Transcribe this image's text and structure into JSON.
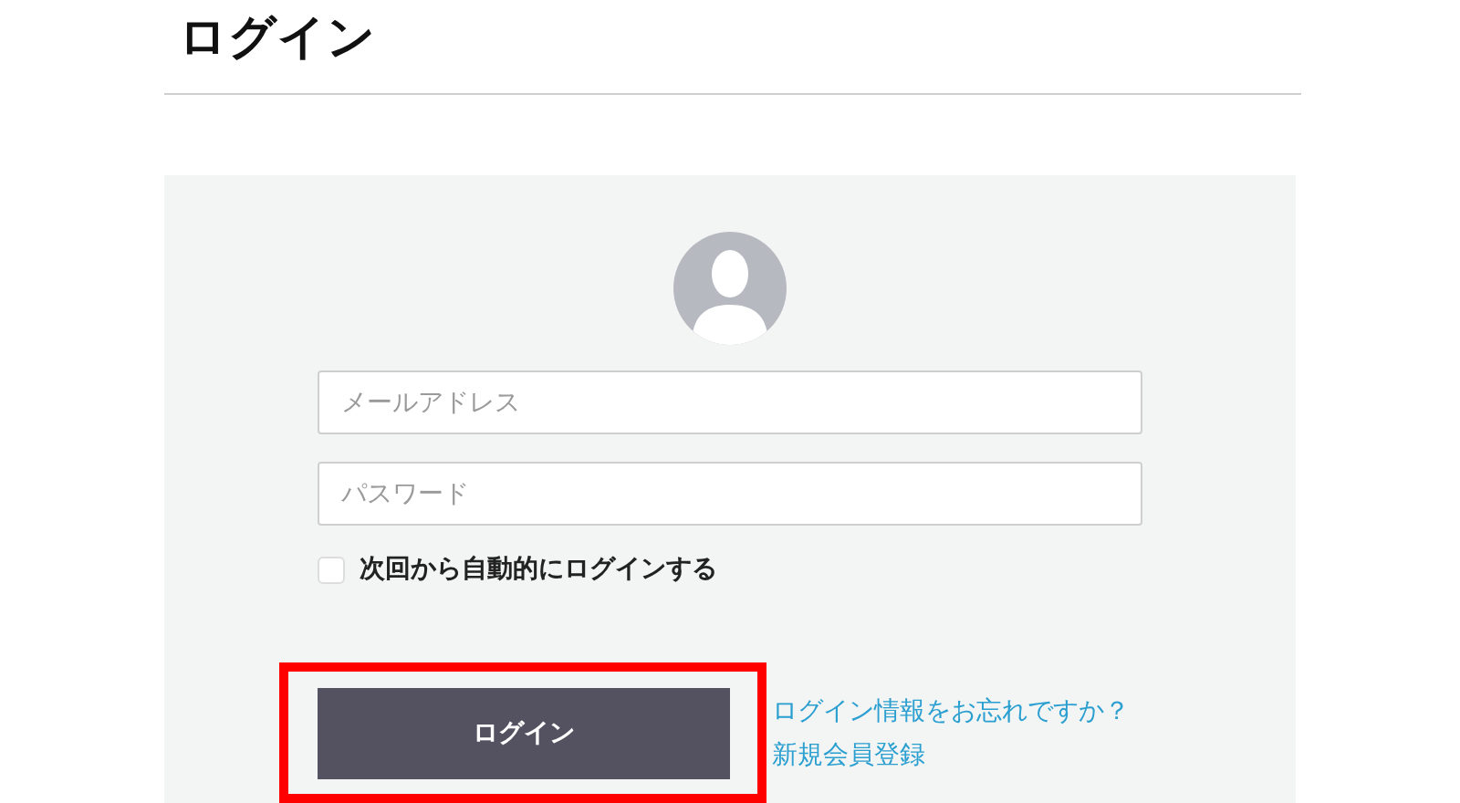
{
  "page_title": "ログイン",
  "login_form": {
    "fields": [
      {
        "placeholder": "メールアドレス"
      },
      {
        "placeholder": "パスワード"
      }
    ],
    "remember_me": {
      "label": "次回から自動的にログインする",
      "checked": false
    },
    "login_button": {
      "label": "ログイン",
      "highlighted": true
    },
    "links": [
      "ログイン情報をお忘れですか？",
      "新規会員登録"
    ]
  }
}
